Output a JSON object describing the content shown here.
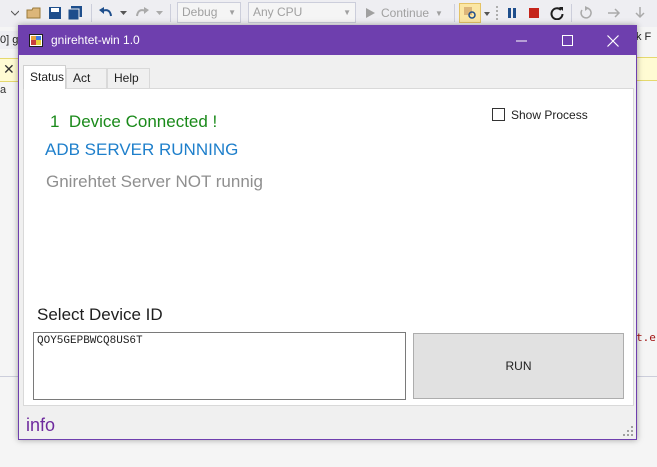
{
  "ide": {
    "debug_config": "Debug",
    "platform": "Any CPU",
    "continue_label": "Continue",
    "left_tab_fragment": "0] g",
    "left_fragment_b": "a",
    "right_fragment_top": "k F",
    "right_code_fragment": "t.e"
  },
  "window": {
    "title": "gnirehtet-win 1.0",
    "colors": {
      "titlebar": "#6e3fae",
      "connected": "#1a8a1a",
      "adb": "#1e7fcb",
      "server": "#8f8f8f",
      "info": "#6e2a9e"
    }
  },
  "tabs": [
    {
      "label": "Status",
      "active": true
    },
    {
      "label": "Act",
      "active": false
    },
    {
      "label": "Help",
      "active": false
    }
  ],
  "status": {
    "device_count": "1",
    "device_text": "Device Connected !",
    "adb": "ADB SERVER RUNNING",
    "server": "Gnirehtet Server NOT runnig",
    "show_process_label": "Show Process",
    "show_process_checked": false
  },
  "device": {
    "select_label": "Select Device ID",
    "device_id": "QOY5GEPBWCQ8US6T",
    "run_label": "RUN"
  },
  "statusbar": {
    "info": "info"
  }
}
